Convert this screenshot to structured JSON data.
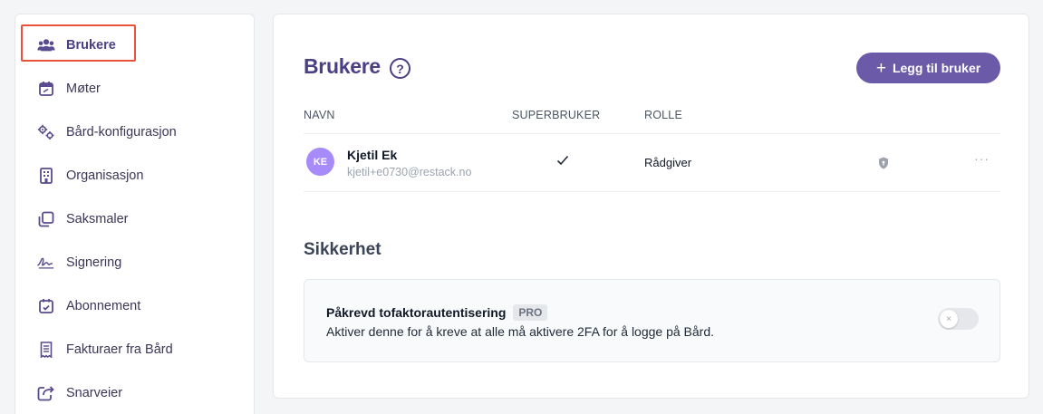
{
  "sidebar": {
    "items": [
      {
        "label": "Brukere",
        "icon": "users-icon",
        "active": true
      },
      {
        "label": "Møter",
        "icon": "calendar-icon"
      },
      {
        "label": "Bård-konfigurasjon",
        "icon": "gears-icon"
      },
      {
        "label": "Organisasjon",
        "icon": "building-icon"
      },
      {
        "label": "Saksmaler",
        "icon": "copy-icon"
      },
      {
        "label": "Signering",
        "icon": "signature-icon"
      },
      {
        "label": "Abonnement",
        "icon": "calendar-check-icon"
      },
      {
        "label": "Fakturaer fra Bård",
        "icon": "receipt-icon"
      },
      {
        "label": "Snarveier",
        "icon": "share-icon"
      }
    ]
  },
  "main": {
    "title": "Brukere",
    "help_icon": "?",
    "add_button": {
      "plus": "+",
      "label": "Legg til bruker"
    },
    "table": {
      "headers": [
        "NAVN",
        "SUPERBRUKER",
        "ROLLE"
      ],
      "rows": [
        {
          "initials": "KE",
          "name": "Kjetil Ek",
          "email": "kjetil+e0730@restack.no",
          "superuser": true,
          "role": "Rådgiver",
          "more": "···"
        }
      ]
    },
    "security": {
      "title": "Sikkerhet",
      "setting_title": "Påkrevd tofaktorautentisering",
      "badge": "PRO",
      "description": "Aktiver denne for å kreve at alle må aktivere 2FA for å logge på Bård.",
      "toggle_on": false,
      "toggle_symbol": "×"
    }
  },
  "colors": {
    "accent": "#6b5aa8",
    "title": "#4b3f86",
    "avatar": "#a78bfa",
    "highlight": "#e8523a"
  }
}
